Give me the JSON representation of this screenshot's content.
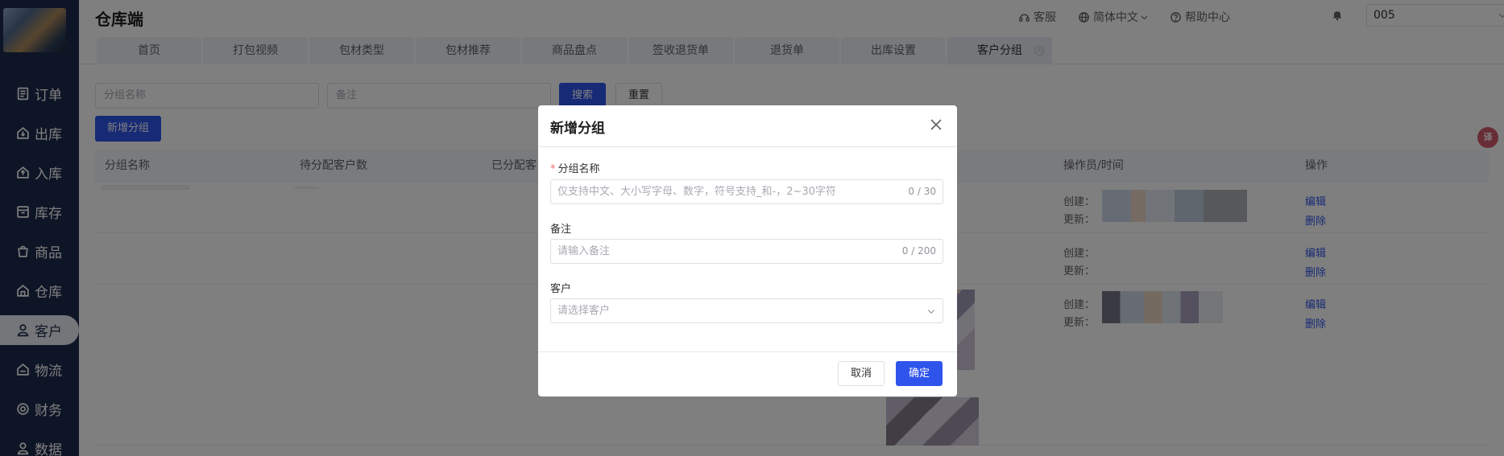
{
  "app": {
    "title": "仓库端"
  },
  "header": {
    "service": "客服",
    "language": "简体中文",
    "help": "帮助中心",
    "warehouse_value": "005"
  },
  "sidebar": {
    "items": [
      {
        "label": "订单",
        "icon": "order-icon"
      },
      {
        "label": "出库",
        "icon": "outbound-icon"
      },
      {
        "label": "入库",
        "icon": "inbound-icon"
      },
      {
        "label": "库存",
        "icon": "inventory-icon"
      },
      {
        "label": "商品",
        "icon": "goods-icon"
      },
      {
        "label": "仓库",
        "icon": "warehouse-icon"
      },
      {
        "label": "客户",
        "icon": "customer-icon",
        "active": true
      },
      {
        "label": "物流",
        "icon": "logistics-icon"
      },
      {
        "label": "财务",
        "icon": "finance-icon"
      },
      {
        "label": "数据",
        "icon": "data-icon"
      }
    ]
  },
  "tabs": [
    {
      "label": "首页"
    },
    {
      "label": "打包视频"
    },
    {
      "label": "包材类型"
    },
    {
      "label": "包材推荐"
    },
    {
      "label": "商品盘点"
    },
    {
      "label": "签收退货单"
    },
    {
      "label": "退货单"
    },
    {
      "label": "出库设置"
    },
    {
      "label": "客户分组",
      "active": true
    }
  ],
  "filters": {
    "group_name_placeholder": "分组名称",
    "remark_placeholder": "备注",
    "search_label": "搜索",
    "reset_label": "重置",
    "add_group_label": "新增分组"
  },
  "table": {
    "columns": [
      "分组名称",
      "待分配客户数",
      "已分配客",
      "操作员/时间",
      "操作"
    ],
    "rows": [
      {
        "created_label": "创建：",
        "updated_label": "更新：",
        "edit": "编辑",
        "delete": "删除"
      },
      {
        "created_label": "创建：",
        "updated_label": "更新：",
        "edit": "编辑",
        "delete": "删除"
      },
      {
        "created_label": "创建：",
        "updated_label": "更新：",
        "edit": "编辑",
        "delete": "删除"
      }
    ]
  },
  "modal": {
    "title": "新增分组",
    "fields": {
      "group_name": {
        "label": "分组名称",
        "required": true,
        "placeholder": "仅支持中文、大小写字母、数字，符号支持_和-，2~30字符",
        "counter": "0 / 30"
      },
      "remark": {
        "label": "备注",
        "placeholder": "请输入备注",
        "counter": "0 / 200"
      },
      "customer": {
        "label": "客户",
        "placeholder": "请选择客户"
      }
    },
    "cancel_label": "取消",
    "confirm_label": "确定"
  },
  "float_tool": {
    "label": "译"
  },
  "colors": {
    "sidebar": "#1d2a4d",
    "primary": "#2f54eb",
    "required": "#f56c6c"
  }
}
